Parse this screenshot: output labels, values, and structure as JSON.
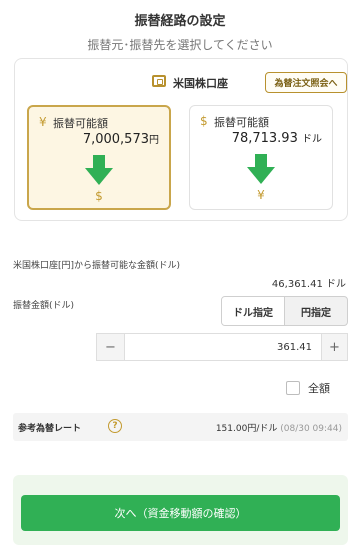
{
  "header": {
    "title": "振替経路の設定",
    "subtitle": "振替元･振替先を選択してください"
  },
  "account": {
    "name": "米国株口座",
    "order_button": "為替注文照会へ"
  },
  "cards": [
    {
      "currency_symbol": "¥",
      "label": "振替可能額",
      "amount": "7,000,573",
      "unit": "円",
      "target_symbol": "$",
      "selected": true
    },
    {
      "currency_symbol": "$",
      "label": "振替可能額",
      "amount": "78,713.93",
      "unit": "ドル",
      "target_symbol": "¥",
      "selected": false
    }
  ],
  "available": {
    "label": "米国株口座[円]から振替可能な金額(ドル)",
    "value": "46,361.41 ドル"
  },
  "amount": {
    "label": "振替金額(ドル)",
    "modes": [
      "ドル指定",
      "円指定"
    ],
    "selected_mode": "ドル指定",
    "value": "361.41",
    "minus": "−",
    "plus": "+"
  },
  "all": {
    "label": "全額",
    "checked": false
  },
  "rate": {
    "label": "参考為替レート",
    "help": "?",
    "value": "151.00",
    "unit": "円/ドル",
    "timestamp": "(08/30 09:44)"
  },
  "footer": {
    "next_button": "次へ（資金移動額の確認）"
  },
  "colors": {
    "accent_green": "#30b055",
    "gold": "#c39a2f",
    "selected_card_bg": "#fdf6e3"
  }
}
